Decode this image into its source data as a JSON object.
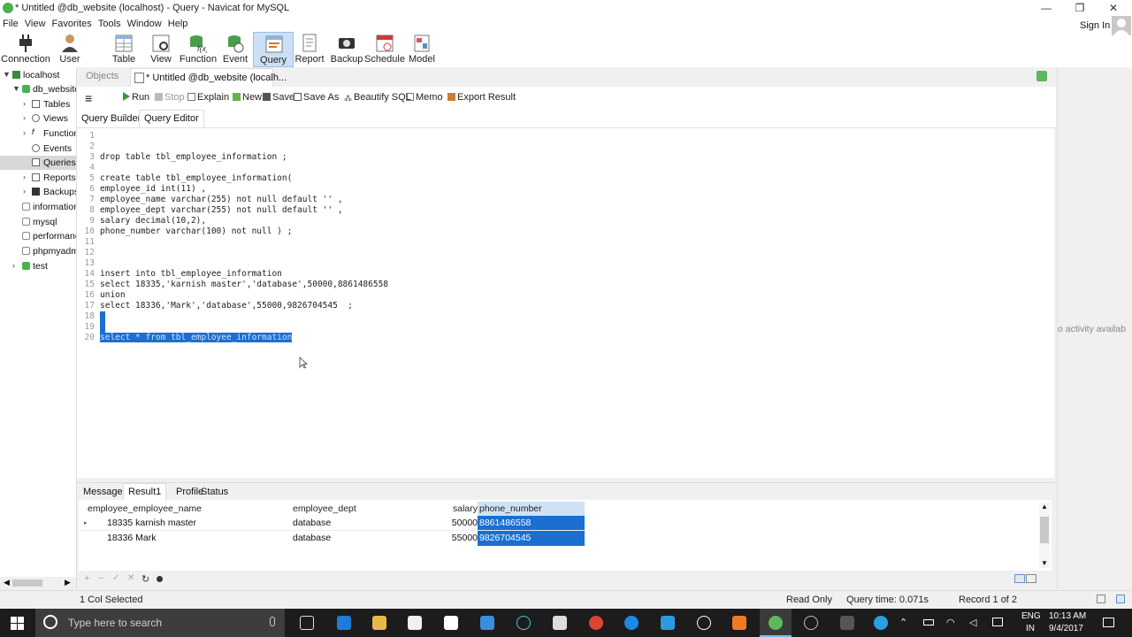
{
  "window": {
    "title": "* Untitled @db_website (localhost) - Query - Navicat for MySQL",
    "controls": [
      "—",
      "❐",
      "✕"
    ]
  },
  "menu": [
    "File",
    "View",
    "Favorites",
    "Tools",
    "Window",
    "Help"
  ],
  "toolbar": {
    "items": [
      "Connection",
      "User",
      "Table",
      "View",
      "Function",
      "Event",
      "Query",
      "Report",
      "Backup",
      "Schedule",
      "Model"
    ],
    "active": "Query",
    "signin": "Sign In"
  },
  "sidebar": {
    "items": [
      {
        "label": "localhost",
        "icon": "server-icon"
      },
      {
        "label": "db_website",
        "icon": "database-icon"
      },
      {
        "label": "Tables",
        "icon": "table-icon"
      },
      {
        "label": "Views",
        "icon": "view-icon"
      },
      {
        "label": "Functions",
        "icon": "function-icon"
      },
      {
        "label": "Events",
        "icon": "event-icon"
      },
      {
        "label": "Queries",
        "icon": "query-icon"
      },
      {
        "label": "Reports",
        "icon": "report-icon"
      },
      {
        "label": "Backups",
        "icon": "backup-icon"
      },
      {
        "label": "information_schema",
        "icon": "database-icon"
      },
      {
        "label": "mysql",
        "icon": "database-icon"
      },
      {
        "label": "performance_schema",
        "icon": "database-icon"
      },
      {
        "label": "phpmyadmin",
        "icon": "database-icon"
      },
      {
        "label": "test",
        "icon": "database-icon"
      }
    ],
    "selected": "Queries"
  },
  "tabs": {
    "objects": "Objects",
    "query": "* Untitled @db_website (localh..."
  },
  "editor_toolbar": {
    "run": "Run",
    "stop": "Stop",
    "explain": "Explain",
    "new": "New",
    "save": "Save",
    "save_as": "Save As",
    "beautify": "Beautify SQL",
    "memo": "Memo",
    "export": "Export Result"
  },
  "subtabs": {
    "builder": "Query Builder",
    "editor": "Query Editor"
  },
  "editor": {
    "lines": [
      "",
      "",
      "drop table tbl_employee_information ;",
      "",
      "create table tbl_employee_information(",
      "employee_id int(11) ,",
      "employee_name varchar(255) not null default '' ,",
      "employee_dept varchar(255) not null default '' ,",
      "salary decimal(10,2),",
      "phone_number varchar(100) not null ) ;",
      "",
      "",
      "",
      "insert into tbl_employee_information",
      "select 18335,'karnish master','database',50000,8861486558",
      "union",
      "select 18336,'Mark','database',55000,9826704545  ;",
      "",
      "",
      "select * from tbl_employee_information"
    ],
    "selected_line": 20
  },
  "results": {
    "tabs": [
      "Message",
      "Result1",
      "Profile",
      "Status"
    ],
    "active_tab": "Result1",
    "columns": [
      "employee_employee_name",
      "employee_dept",
      "salary",
      "phone_number"
    ],
    "rows": [
      [
        "18335 karnish master",
        "database",
        "50000",
        "8861486558"
      ],
      [
        "18336 Mark",
        "database",
        "55000",
        "9826704545"
      ]
    ]
  },
  "status": {
    "left": "1 Col Selected",
    "mode": "Read Only",
    "time": "Query time: 0.071s",
    "record": "Record 1 of 2"
  },
  "right_panel": {
    "text": "o activity availab"
  },
  "taskbar": {
    "search_placeholder": "Type here to search",
    "lang": "ENG",
    "region": "IN",
    "time": "10:13 AM",
    "date": "9/4/2017"
  }
}
